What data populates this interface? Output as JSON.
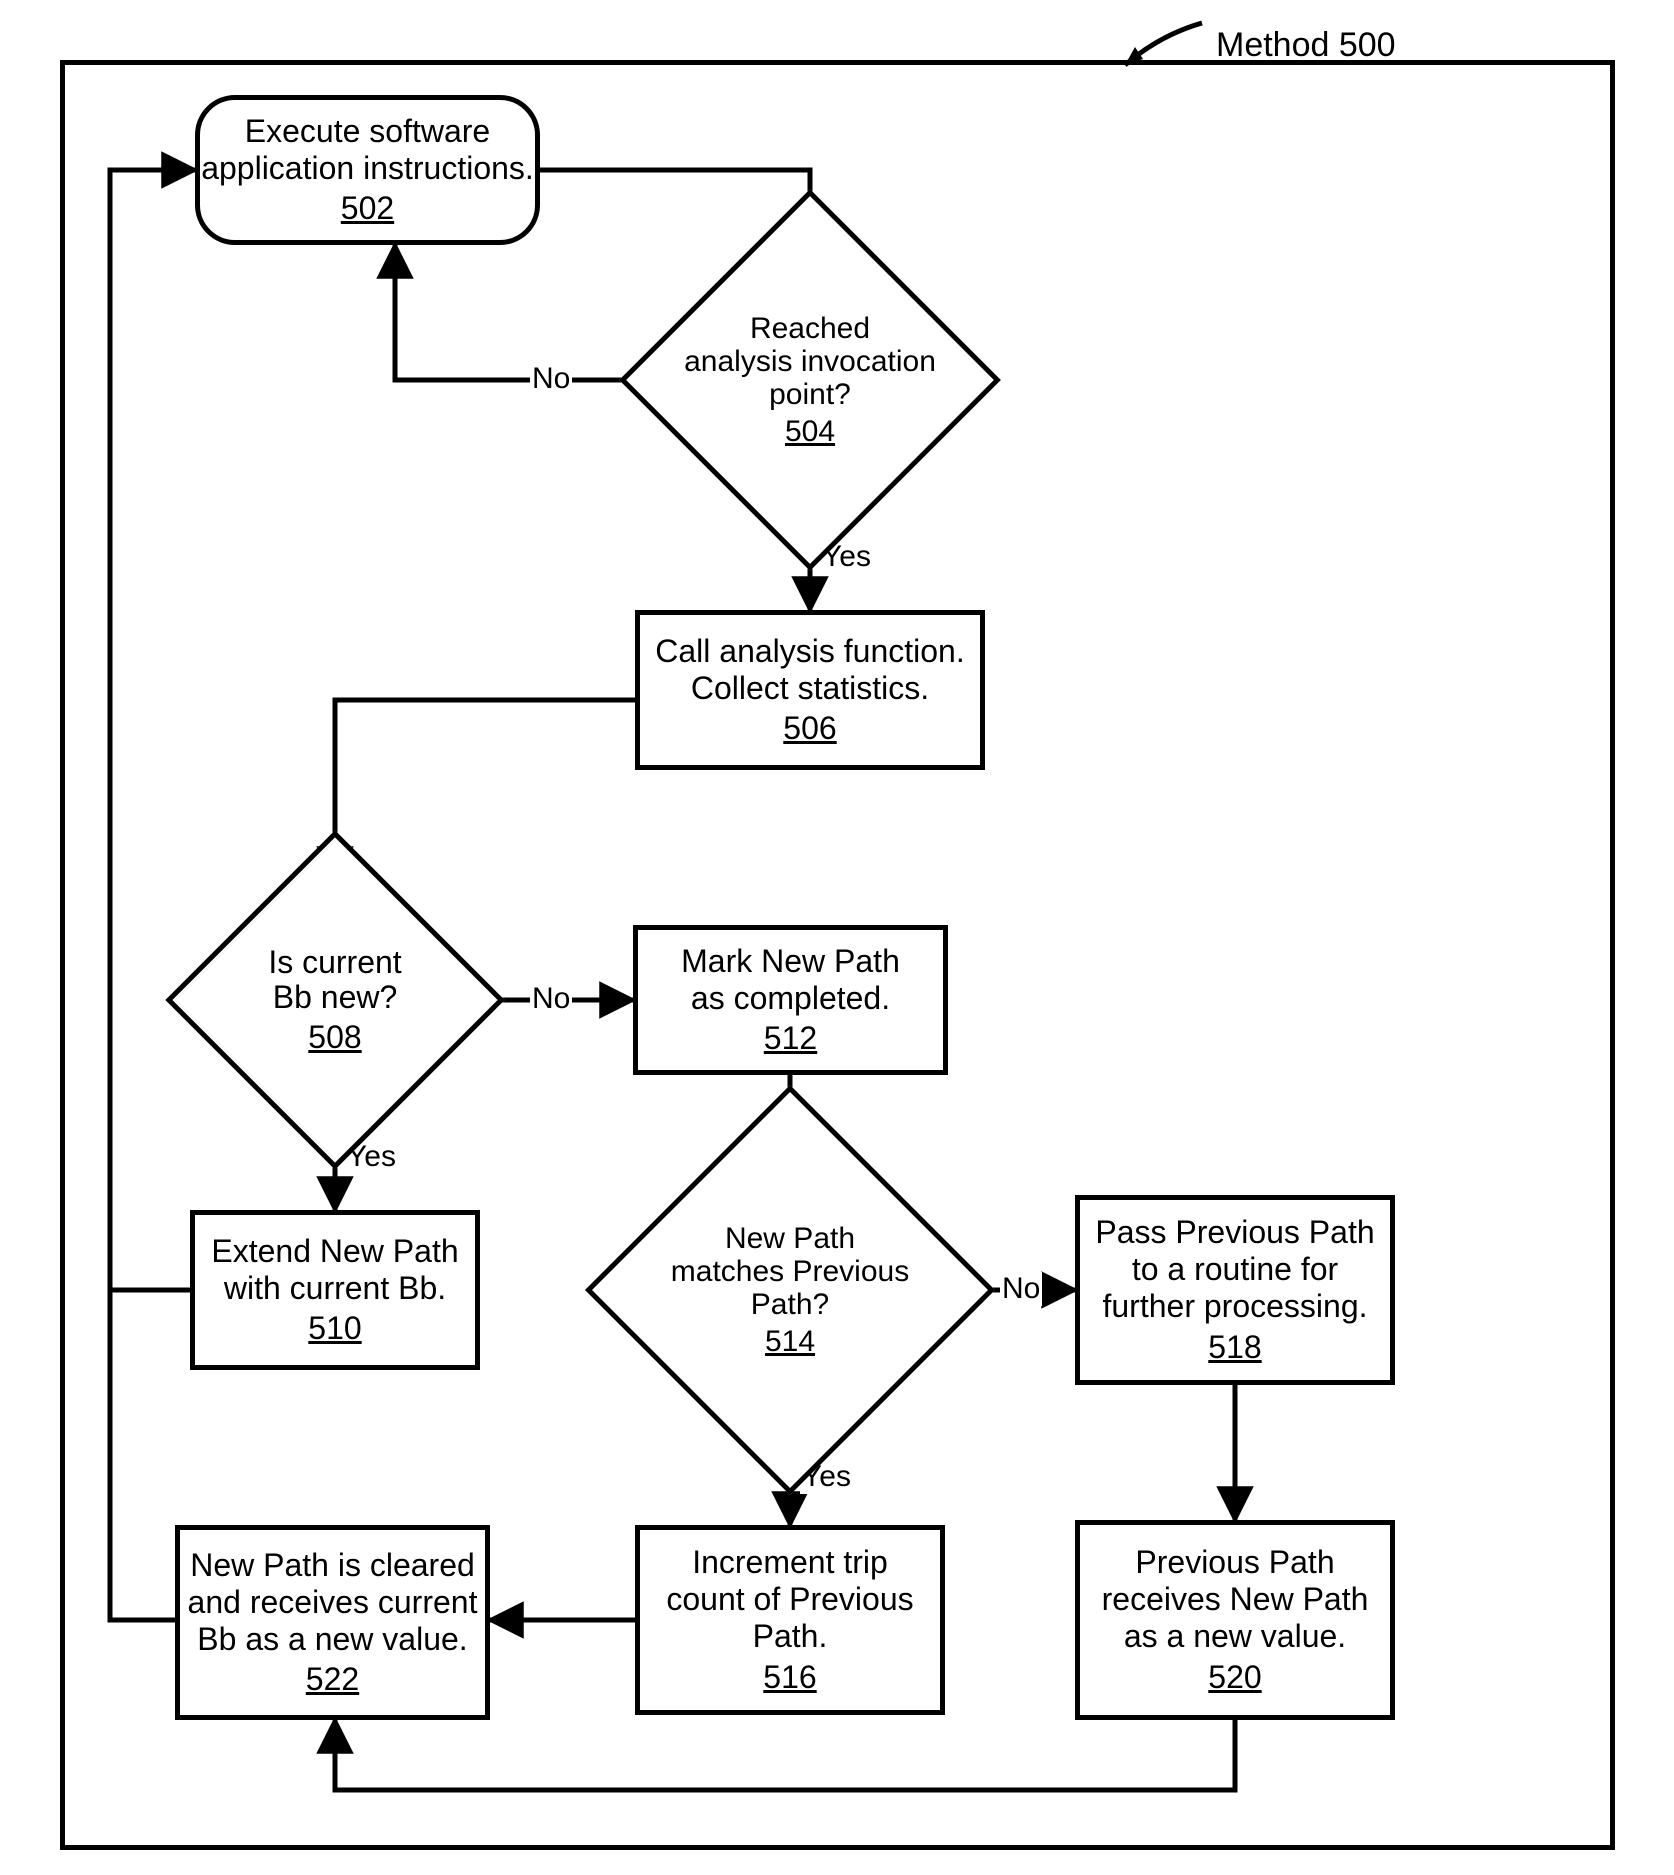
{
  "chart_data": {
    "type": "flowchart",
    "title": "Method 500",
    "nodes": [
      {
        "id": "502",
        "type": "terminator",
        "text": "Execute software application instructions."
      },
      {
        "id": "504",
        "type": "decision",
        "text": "Reached analysis invocation point?"
      },
      {
        "id": "506",
        "type": "process",
        "text": "Call analysis function. Collect statistics."
      },
      {
        "id": "508",
        "type": "decision",
        "text": "Is current Bb new?"
      },
      {
        "id": "510",
        "type": "process",
        "text": "Extend New Path with current Bb."
      },
      {
        "id": "512",
        "type": "process",
        "text": "Mark New Path as completed."
      },
      {
        "id": "514",
        "type": "decision",
        "text": "New Path matches Previous Path?"
      },
      {
        "id": "516",
        "type": "process",
        "text": "Increment trip count of Previous Path."
      },
      {
        "id": "518",
        "type": "process",
        "text": "Pass Previous Path to a routine for further processing."
      },
      {
        "id": "520",
        "type": "process",
        "text": "Previous Path receives New Path as a new value."
      },
      {
        "id": "522",
        "type": "process",
        "text": "New Path is cleared and receives current Bb as a new value."
      }
    ],
    "edges": [
      {
        "from": "502",
        "to": "504",
        "label": null
      },
      {
        "from": "504",
        "to": "502",
        "label": "No"
      },
      {
        "from": "504",
        "to": "506",
        "label": "Yes"
      },
      {
        "from": "506",
        "to": "508",
        "label": null
      },
      {
        "from": "508",
        "to": "510",
        "label": "Yes"
      },
      {
        "from": "508",
        "to": "512",
        "label": "No"
      },
      {
        "from": "510",
        "to": "502",
        "label": null
      },
      {
        "from": "512",
        "to": "514",
        "label": null
      },
      {
        "from": "514",
        "to": "516",
        "label": "Yes"
      },
      {
        "from": "514",
        "to": "518",
        "label": "No"
      },
      {
        "from": "516",
        "to": "522",
        "label": null
      },
      {
        "from": "518",
        "to": "520",
        "label": null
      },
      {
        "from": "520",
        "to": "522",
        "label": null
      },
      {
        "from": "522",
        "to": "502",
        "label": null
      }
    ]
  },
  "labels": {
    "title": "Method 500",
    "yes": "Yes",
    "no": "No"
  },
  "nodes": {
    "n502": {
      "l1": "Execute software",
      "l2": "application instructions.",
      "num": "502"
    },
    "n504": {
      "l1": "Reached",
      "l2": "analysis invocation",
      "l3": "point?",
      "num": "504"
    },
    "n506": {
      "l1": "Call analysis function.",
      "l2": "Collect statistics.",
      "num": "506"
    },
    "n508": {
      "l1": "Is current",
      "l2": "Bb new?",
      "num": "508"
    },
    "n510": {
      "l1": "Extend New Path",
      "l2": "with current Bb.",
      "num": "510"
    },
    "n512": {
      "l1": "Mark New Path",
      "l2": "as completed.",
      "num": "512"
    },
    "n514": {
      "l1": "New Path",
      "l2": "matches Previous",
      "l3": "Path?",
      "num": "514"
    },
    "n516": {
      "l1": "Increment trip",
      "l2": "count of Previous",
      "l3": "Path.",
      "num": "516"
    },
    "n518": {
      "l1": "Pass Previous Path",
      "l2": "to a routine for",
      "l3": "further processing.",
      "num": "518"
    },
    "n520": {
      "l1": "Previous Path",
      "l2": "receives New Path",
      "l3": "as a new value.",
      "num": "520"
    },
    "n522": {
      "l1": "New Path is cleared",
      "l2": "and receives current",
      "l3": "Bb as a new value.",
      "num": "522"
    }
  }
}
